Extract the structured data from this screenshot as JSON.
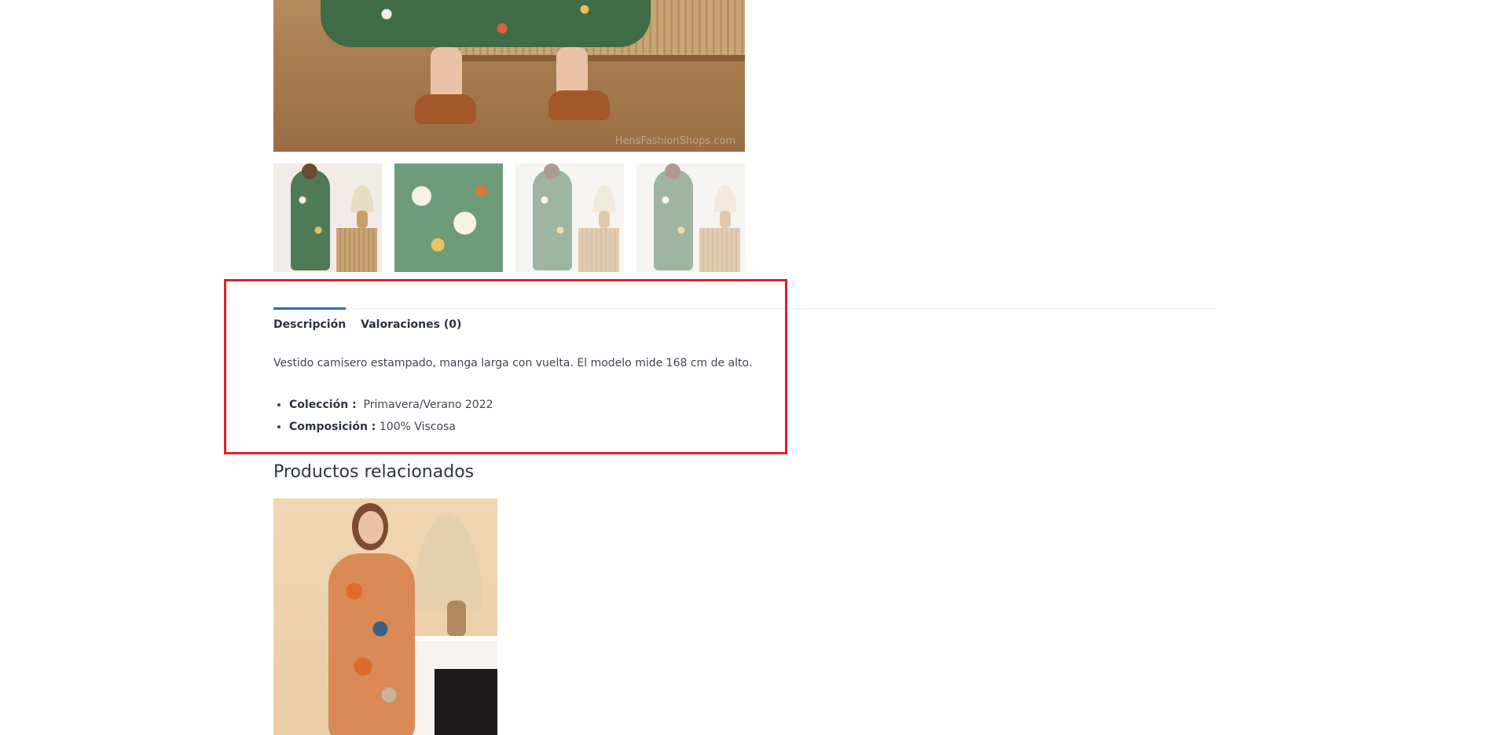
{
  "product": {
    "main_image_watermark": "HensFashionShops.com"
  },
  "tabs": [
    {
      "label": "Descripción",
      "active": true
    },
    {
      "label": "Valoraciones (0)",
      "active": false
    }
  ],
  "description": {
    "text": "Vestido camisero estampado, manga larga con vuelta. El modelo mide 168 cm de alto.",
    "attributes": [
      {
        "key": "Colección :",
        "value": "Primavera/Verano 2022"
      },
      {
        "key": "Composición :",
        "value": "100% Viscosa"
      }
    ]
  },
  "related": {
    "title": "Productos relacionados"
  },
  "colors": {
    "tab_active_accent": "#2a6fb0",
    "highlight_border": "#e0212b"
  }
}
